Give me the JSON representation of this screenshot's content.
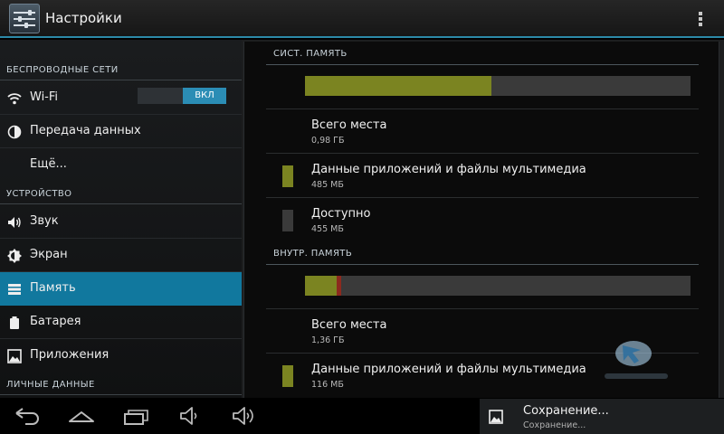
{
  "action_bar": {
    "title": "Настройки",
    "overflow_icon": "overflow-menu-icon"
  },
  "sidebar": {
    "sections": [
      {
        "header": "БЕСПРОВОДНЫЕ СЕТИ"
      },
      {
        "header": "УСТРОЙСТВО"
      },
      {
        "header": "ЛИЧНЫЕ ДАННЫЕ"
      }
    ],
    "items": [
      {
        "label": "Wi-Fi",
        "icon": "wifi-icon",
        "toggle": "ВКЛ"
      },
      {
        "label": "Передача данных",
        "icon": "data-usage-icon"
      },
      {
        "label": "Ещё..."
      },
      {
        "label": "Звук",
        "icon": "sound-icon"
      },
      {
        "label": "Экран",
        "icon": "display-icon"
      },
      {
        "label": "Память",
        "icon": "storage-icon",
        "selected": true
      },
      {
        "label": "Батарея",
        "icon": "battery-icon"
      },
      {
        "label": "Приложения",
        "icon": "apps-icon"
      }
    ]
  },
  "storage": {
    "system": {
      "header": "СИСТ. ПАМЯТЬ",
      "bar": {
        "used_fraction": 0.483,
        "used_color": "#7b8421",
        "free_color": "#3a3a3a"
      },
      "rows": [
        {
          "title": "Всего места",
          "value": "0,98 ГБ"
        },
        {
          "title": "Данные приложений и файлы мультимедиа",
          "value": "485 МБ",
          "swatch": "#7b8421"
        },
        {
          "title": "Доступно",
          "value": "455 МБ",
          "swatch": "#3a3a3a"
        }
      ]
    },
    "internal": {
      "header": "ВНУТР. ПАМЯТЬ",
      "bar": {
        "used_fraction": 0.082,
        "other_fraction": 0.012,
        "used_color": "#7b8421",
        "other_color": "#8c2a1e",
        "free_color": "#3a3a3a"
      },
      "rows": [
        {
          "title": "Всего места",
          "value": "1,36 ГБ"
        },
        {
          "title": "Данные приложений и файлы мультимедиа",
          "value": "116 МБ",
          "swatch": "#7b8421"
        }
      ]
    }
  },
  "navbar": {
    "buttons": [
      "back-icon",
      "home-icon",
      "recent-apps-icon",
      "volume-down-icon",
      "volume-up-icon"
    ]
  },
  "notification": {
    "title": "Сохранение...",
    "subtitle": "Сохранение...",
    "icon": "picture-icon"
  },
  "colors": {
    "accent": "#11789e",
    "toggle_on": "#2b8db5",
    "media_segment": "#7b8421"
  }
}
